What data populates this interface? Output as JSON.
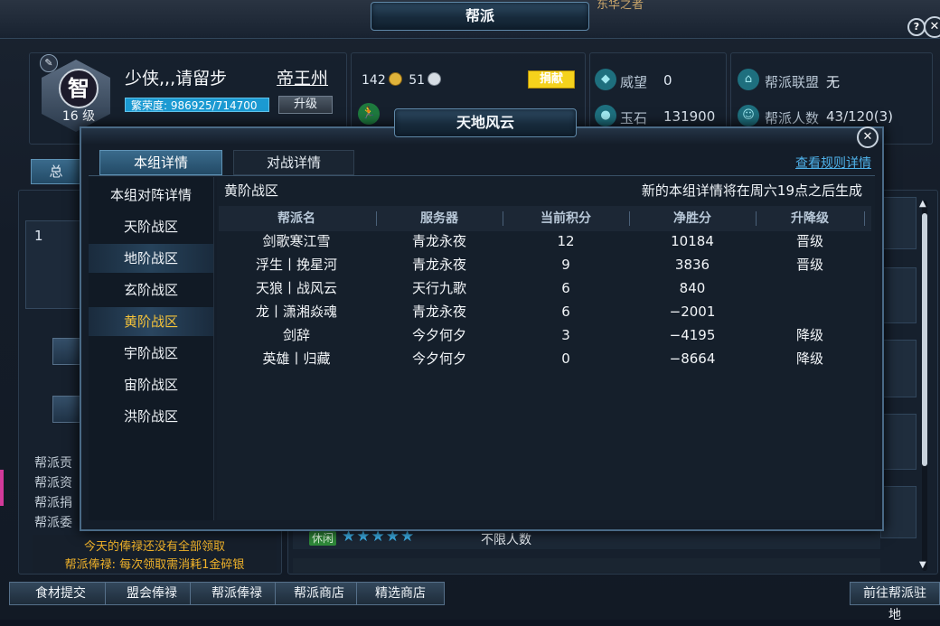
{
  "main": {
    "title": "帮派",
    "top_right_text": "东华之者",
    "help_icon": "?",
    "close_icon": "✕",
    "guild_name": "少侠,,,请留步",
    "guild_level_icon": "智",
    "guild_level": "16 级",
    "server_name": "帝王州",
    "prosperity": "繁荣度: 986925/714700",
    "upgrade_label": "升级",
    "gold": "142",
    "silver": "51",
    "donate_label": "捐献",
    "prestige_label": "威望",
    "prestige_value": "0",
    "jade_label": "玉石",
    "jade_value": "131900",
    "alliance_label": "帮派联盟",
    "alliance_value": "无",
    "members_label": "帮派人数",
    "members_value": "43/120(3)",
    "left_tab_label": "总",
    "left_list_first": "1",
    "left_labels": [
      "帮派贡",
      "帮派资",
      "帮派捐",
      "帮派委"
    ],
    "salary_notice_1": "今天的俸禄还没有全部领取",
    "salary_notice_2": "帮派俸禄: 每次领取需消耗1金碎银",
    "idle_badge": "休闲",
    "stars": "★★★★★",
    "unlimited_people": "不限人数"
  },
  "bottom_bar": {
    "buttons": [
      "食材提交",
      "盟会俸禄",
      "帮派俸禄",
      "帮派商店",
      "精选商店"
    ],
    "goto_button": "前往帮派驻地"
  },
  "modal": {
    "title": "天地风云",
    "close_icon": "✕",
    "tabs": [
      "本组详情",
      "对战详情"
    ],
    "rules_link": "查看规则详情",
    "sidebar_items": [
      "本组对阵详情",
      "天阶战区",
      "地阶战区",
      "玄阶战区",
      "黄阶战区",
      "宇阶战区",
      "宙阶战区",
      "洪阶战区"
    ],
    "zone_title": "黄阶战区",
    "notice": "新的本组详情将在周六19点之后生成",
    "columns": [
      "帮派名",
      "服务器",
      "当前积分",
      "净胜分",
      "升降级"
    ],
    "rows": [
      [
        "剑歌寒江雪",
        "青龙永夜",
        "12",
        "10184",
        "晋级"
      ],
      [
        "浮生丨挽星河",
        "青龙永夜",
        "9",
        "3836",
        "晋级"
      ],
      [
        "天狼丨战风云",
        "天行九歌",
        "6",
        "840",
        ""
      ],
      [
        "龙丨潇湘焱魂",
        "青龙永夜",
        "6",
        "−2001",
        ""
      ],
      [
        "剑辞",
        "今夕何夕",
        "3",
        "−4195",
        "降级"
      ],
      [
        "英雄丨归藏",
        "今夕何夕",
        "0",
        "−8664",
        "降级"
      ]
    ]
  }
}
